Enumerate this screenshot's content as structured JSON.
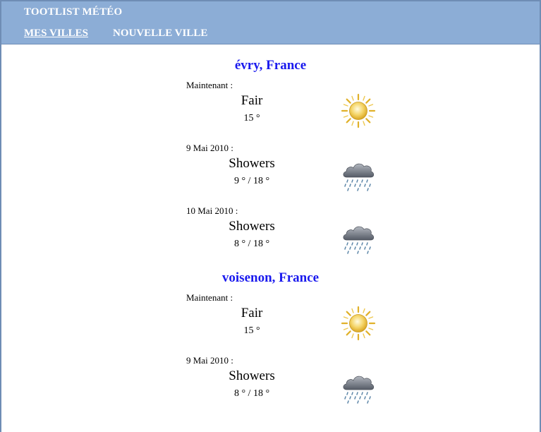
{
  "app": {
    "title": "TOOTLIST MÉTÉO"
  },
  "nav": {
    "items": [
      {
        "label": "MES VILLES",
        "active": true
      },
      {
        "label": "NOUVELLE VILLE",
        "active": false
      }
    ]
  },
  "cities": [
    {
      "name": "évry, France",
      "entries": [
        {
          "date": "Maintenant :",
          "condition": "Fair",
          "temp": "15 °",
          "icon": "sun-icon"
        },
        {
          "date": "9 Mai 2010 :",
          "condition": "Showers",
          "temp": "9 ° / 18 °",
          "icon": "rain-cloud-icon"
        },
        {
          "date": "10 Mai 2010 :",
          "condition": "Showers",
          "temp": "8 ° / 18 °",
          "icon": "rain-cloud-icon"
        }
      ]
    },
    {
      "name": "voisenon, France",
      "entries": [
        {
          "date": "Maintenant :",
          "condition": "Fair",
          "temp": "15 °",
          "icon": "sun-icon"
        },
        {
          "date": "9 Mai 2010 :",
          "condition": "Showers",
          "temp": "8 ° / 18 °",
          "icon": "rain-cloud-icon"
        }
      ]
    }
  ],
  "colors": {
    "header_bg": "#8cadd6",
    "city_title": "#1a1aee"
  }
}
